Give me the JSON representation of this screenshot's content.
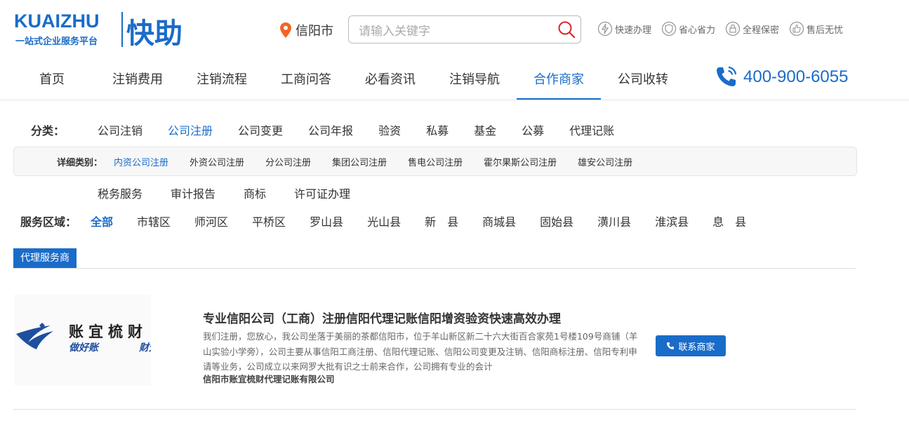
{
  "logo": {
    "en": "KUAIZHU",
    "sub": "一站式企业服务平台",
    "cn": "快助"
  },
  "city": "信阳市",
  "search": {
    "placeholder": "请输入关键字"
  },
  "features": [
    "快速办理",
    "省心省力",
    "全程保密",
    "售后无忧"
  ],
  "nav": {
    "items": [
      "首页",
      "注销费用",
      "注销流程",
      "工商问答",
      "必看资讯",
      "注销导航",
      "合作商家",
      "公司收转"
    ],
    "active_index": 6
  },
  "hotline": "400-900-6055",
  "category": {
    "label": "分类：",
    "items": [
      "公司注销",
      "公司注册",
      "公司变更",
      "公司年报",
      "验资",
      "私募",
      "基金",
      "公募",
      "代理记账"
    ],
    "items2": [
      "税务服务",
      "审计报告",
      "商标",
      "许可证办理"
    ],
    "active": "公司注册"
  },
  "subcategory": {
    "label": "详细类别：",
    "items": [
      "内资公司注册",
      "外资公司注册",
      "分公司注册",
      "集团公司注册",
      "售电公司注册",
      "霍尔果斯公司注册",
      "雄安公司注册"
    ],
    "active": "内资公司注册"
  },
  "area": {
    "label": "服务区域：",
    "items": [
      "全部",
      "市辖区",
      "师河区",
      "平桥区",
      "罗山县",
      "光山县",
      "新　县",
      "商城县",
      "固始县",
      "潢川县",
      "淮滨县",
      "息　县"
    ],
    "active": "全部"
  },
  "list": {
    "tab": "代理服务商",
    "cards": [
      {
        "logo_main": "账宜梳财",
        "logo_left": "做好账",
        "logo_right": "财无忧",
        "title": "专业信阳公司（工商）注册信阳代理记账信阳增资验资快速高效办理",
        "desc": "我们注册，您放心，我公司坐落于美丽的茶都信阳市，位于羊山新区新二十六大街百合家苑1号楼109号商铺（羊山实验小学旁），公司主要从事信阳工商注册、信阳代理记账、信阳公司变更及注销、信阳商标注册、信阳专利申请等业务，公司成立以来网罗大批有识之士前来合作，公司拥有专业的会计",
        "company": "信阳市账宜梳财代理记账有限公司",
        "contact_label": "联系商家"
      }
    ]
  },
  "colors": {
    "brand": "#1a6cc9",
    "pin": "#f26522"
  }
}
